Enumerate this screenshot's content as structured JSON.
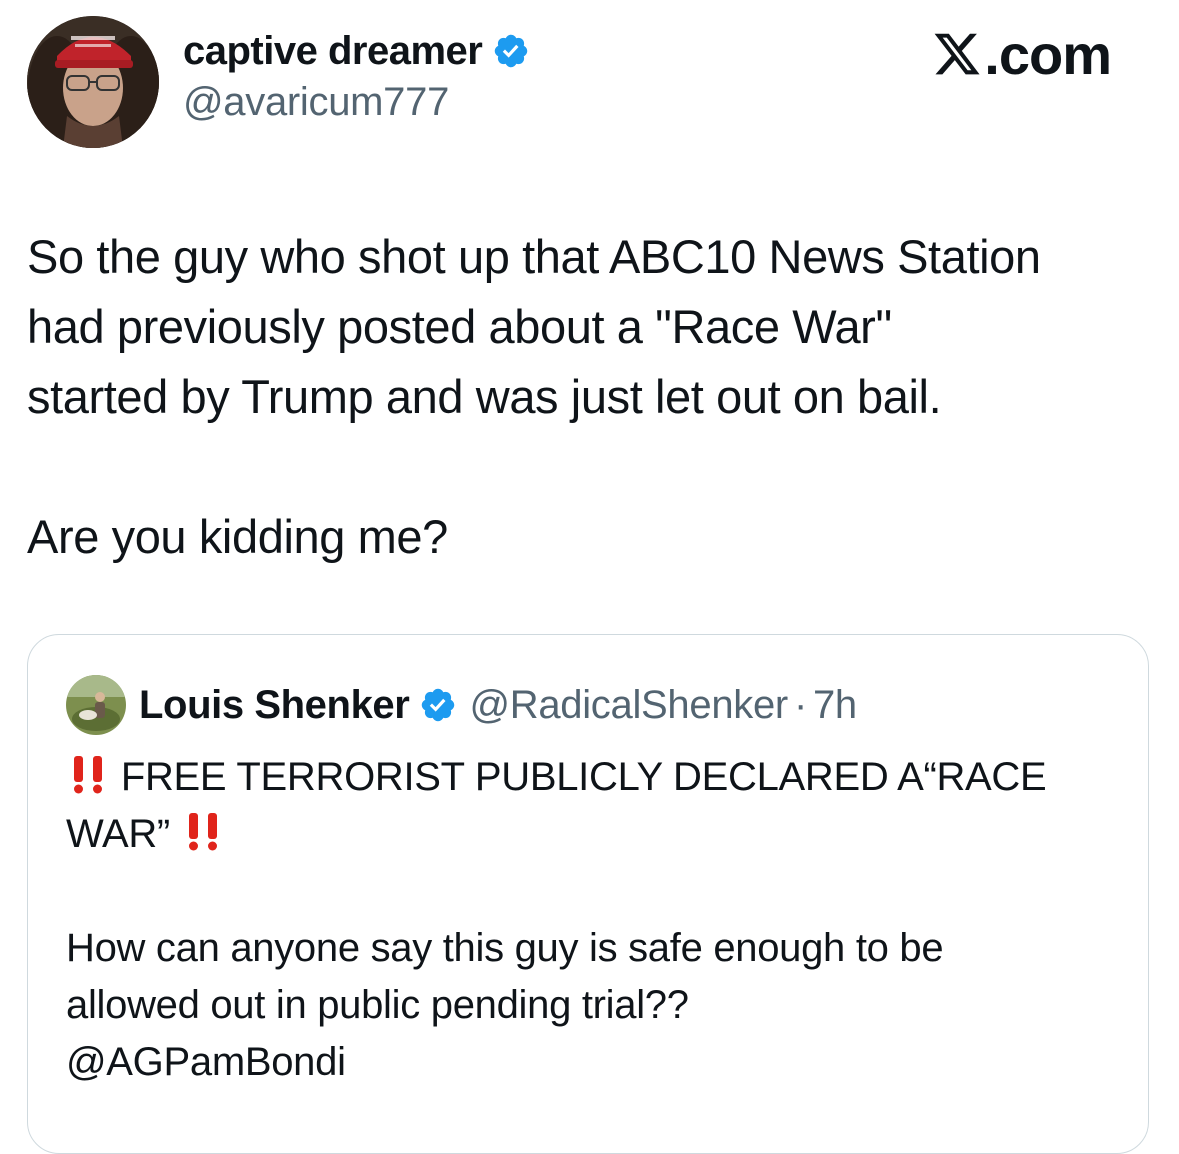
{
  "author": {
    "display_name": "captive dreamer",
    "handle": "@avaricum777",
    "verified_icon": "verified-badge-icon",
    "avatar_icon": "avatar-image"
  },
  "brand": {
    "logo_icon": "x-logo-icon",
    "text": ".com"
  },
  "tweet": {
    "line1": "So the guy who shot up that ABC10 News Station",
    "line2": "had previously posted about a \"Race War\"",
    "line3": "started by Trump and was just let out on bail.",
    "line4": "Are you kidding me?"
  },
  "quote": {
    "display_name": "Louis Shenker",
    "handle": "@RadicalShenker",
    "separator": "·",
    "time": "7h",
    "headline_part1": " FREE TERRORIST PUBLICLY DECLARED A“RACE",
    "headline_part2": "WAR” ",
    "body_line1": "How can anyone say this guy is safe enough to be",
    "body_line2": "allowed out in public pending trial??",
    "mention": "@AGPamBondi",
    "emoji_icon": "double-exclamation-icon"
  },
  "colors": {
    "verified_blue": "#1d9bf0",
    "secondary_text": "#536471",
    "primary_text": "#0f1419",
    "border": "#cfd9de",
    "emoji_red": "#e0241b"
  }
}
